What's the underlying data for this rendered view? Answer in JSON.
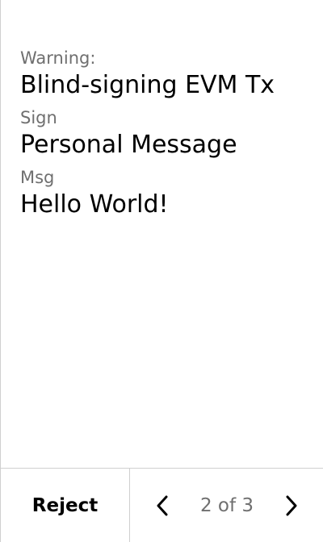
{
  "review": {
    "fields": [
      {
        "label": "Warning:",
        "value": "Blind-signing EVM Tx"
      },
      {
        "label": "Sign",
        "value": "Personal Message"
      },
      {
        "label": "Msg",
        "value": "Hello World!"
      }
    ]
  },
  "footer": {
    "reject_label": "Reject",
    "page_indicator": "2 of 3",
    "current_page": 2,
    "total_pages": 3,
    "prev_icon": "chevron-left-icon",
    "next_icon": "chevron-right-icon"
  },
  "colors": {
    "background": "#ffffff",
    "text_primary": "#000000",
    "text_secondary": "#6f6f6f",
    "divider": "#cfcfcf"
  }
}
